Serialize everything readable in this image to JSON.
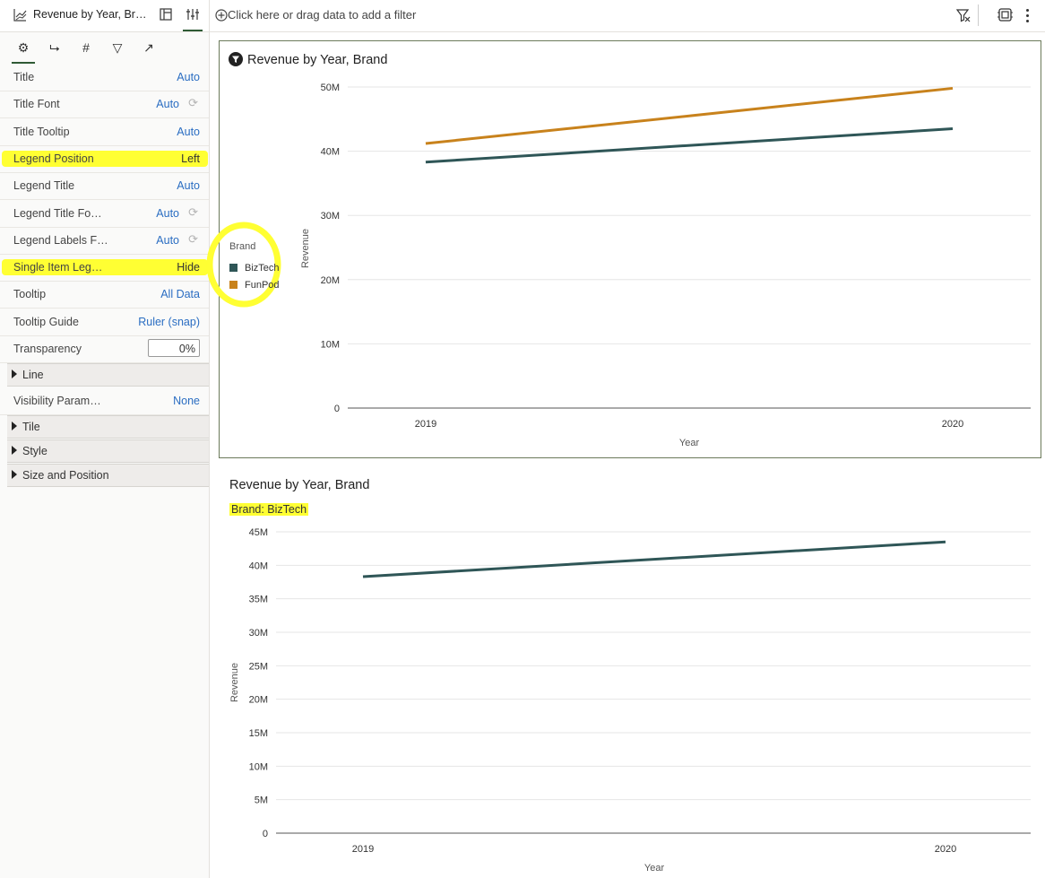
{
  "left_panel": {
    "viz_title": "Revenue by Year, Br…",
    "tabs": [
      {
        "name": "gear-icon",
        "glyph": "⚙",
        "active": true
      },
      {
        "name": "axis-icon",
        "glyph": "⮡"
      },
      {
        "name": "hash-icon",
        "glyph": "#"
      },
      {
        "name": "filter-icon",
        "glyph": "▽"
      },
      {
        "name": "trend-icon",
        "glyph": "↗"
      }
    ],
    "properties": [
      {
        "label": "Title",
        "value": "Auto"
      },
      {
        "label": "Title Font",
        "value": "Auto",
        "reset": true
      },
      {
        "label": "Title Tooltip",
        "value": "Auto"
      },
      {
        "label": "Legend Position",
        "value": "Left",
        "highlight": true
      },
      {
        "label": "Legend Title",
        "value": "Auto"
      },
      {
        "label": "Legend Title Fo…",
        "value": "Auto",
        "reset": true
      },
      {
        "label": "Legend Labels F…",
        "value": "Auto",
        "reset": true
      },
      {
        "label": "Single Item Leg…",
        "value": "Hide",
        "highlight": true
      },
      {
        "label": "Tooltip",
        "value": "All Data"
      },
      {
        "label": "Tooltip Guide",
        "value": "Ruler (snap)"
      }
    ],
    "transparency": {
      "label": "Transparency",
      "value": "0%"
    },
    "sections": {
      "line": "Line",
      "visibility_label": "Visibility Param…",
      "visibility_value": "None",
      "tile": "Tile",
      "style": "Style",
      "size_position": "Size and Position"
    }
  },
  "filter_bar": {
    "placeholder": "Click here or drag data to add a filter"
  },
  "colors": {
    "biztech": "#2f5657",
    "funpod": "#c8821c",
    "highlight": "#ffff33",
    "link": "#2a6dc2"
  },
  "chart_data": [
    {
      "type": "line",
      "title": "Revenue by Year, Brand",
      "xlabel": "Year",
      "ylabel": "Revenue",
      "categories": [
        "2019",
        "2020"
      ],
      "series": [
        {
          "name": "BizTech",
          "values": [
            38300000,
            43500000
          ]
        },
        {
          "name": "FunPod",
          "values": [
            41200000,
            49800000
          ]
        }
      ],
      "ylim": [
        0,
        50000000
      ],
      "yticks": [
        0,
        10000000,
        20000000,
        30000000,
        40000000,
        50000000
      ],
      "ytick_labels": [
        "0",
        "10M",
        "20M",
        "30M",
        "40M",
        "50M"
      ],
      "legend": {
        "title": "Brand",
        "position": "left"
      }
    },
    {
      "type": "line",
      "title": "Revenue by Year, Brand",
      "subtitle": "Brand: BizTech",
      "xlabel": "Year",
      "ylabel": "Revenue",
      "categories": [
        "2019",
        "2020"
      ],
      "series": [
        {
          "name": "BizTech",
          "values": [
            38300000,
            43500000
          ]
        }
      ],
      "ylim": [
        0,
        45000000
      ],
      "yticks": [
        0,
        5000000,
        10000000,
        15000000,
        20000000,
        25000000,
        30000000,
        35000000,
        40000000,
        45000000
      ],
      "ytick_labels": [
        "0",
        "5M",
        "10M",
        "15M",
        "20M",
        "25M",
        "30M",
        "35M",
        "40M",
        "45M"
      ]
    }
  ]
}
